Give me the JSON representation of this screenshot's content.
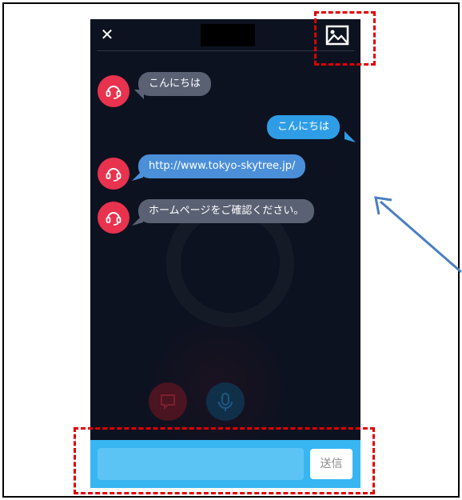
{
  "header": {
    "close_icon": "close-icon",
    "image_icon": "image-icon"
  },
  "messages": [
    {
      "sender": "operator",
      "text": "こんにちは"
    },
    {
      "sender": "user",
      "text": "こんにちは"
    },
    {
      "sender": "operator",
      "text": "http://www.tokyo-skytree.jp/"
    },
    {
      "sender": "operator",
      "text": "ホームページをご確認ください。"
    }
  ],
  "actions": {
    "chat_icon": "chat-bubble-icon",
    "mic_icon": "microphone-icon"
  },
  "input": {
    "value": "",
    "placeholder": ""
  },
  "send_label": "送信",
  "colors": {
    "operator_avatar": "#e8324e",
    "operator_bubble": "#5a6173",
    "user_bubble": "#2f9de6",
    "input_bar": "#38b6f2",
    "highlight": "#e00000",
    "arrow": "#4a7fc1"
  }
}
